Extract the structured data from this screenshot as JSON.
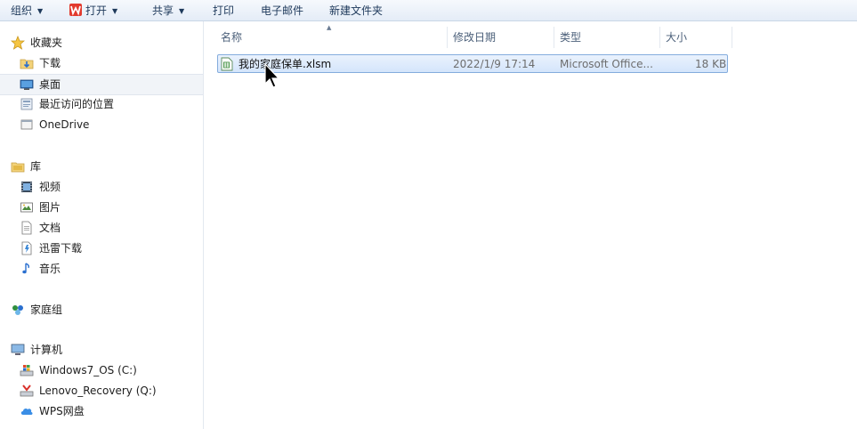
{
  "toolbar": {
    "organize": "组织",
    "open": "打开",
    "share": "共享",
    "print": "打印",
    "email": "电子邮件",
    "new_folder": "新建文件夹"
  },
  "sidebar": {
    "favorites": {
      "label": "收藏夹",
      "items": [
        "下载",
        "桌面",
        "最近访问的位置",
        "OneDrive"
      ]
    },
    "library": {
      "label": "库",
      "items": [
        "视频",
        "图片",
        "文档",
        "迅雷下载",
        "音乐"
      ]
    },
    "homegroup": "家庭组",
    "computer": {
      "label": "计算机",
      "items": [
        "Windows7_OS (C:)",
        "Lenovo_Recovery (Q:)",
        "WPS网盘"
      ]
    }
  },
  "columns": {
    "name": "名称",
    "modified": "修改日期",
    "type": "类型",
    "size": "大小"
  },
  "files": [
    {
      "name": "我的家庭保单.xlsm",
      "modified": "2022/1/9 17:14",
      "type": "Microsoft Office...",
      "size": "18 KB"
    }
  ],
  "colors": {
    "toolbar_text": "#1e395b",
    "selection_border": "#84acdd",
    "header_text": "#4c607a"
  }
}
